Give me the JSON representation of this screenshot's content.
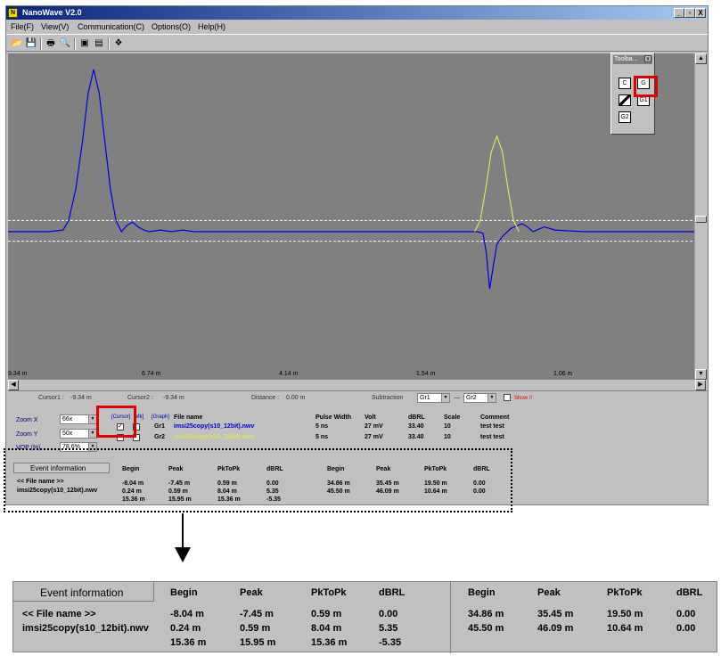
{
  "window": {
    "title": "NanoWave V2.0",
    "menus": [
      "File(F)",
      "View(V)",
      "Communication(C)",
      "Options(O)",
      "Help(H)"
    ],
    "caption_buttons": [
      "_",
      "▫",
      "X"
    ]
  },
  "palette": {
    "title": "Toolba...",
    "close": "x",
    "buttons": [
      "C",
      "G",
      "",
      "G1",
      "G2"
    ]
  },
  "plot": {
    "background": "#808080",
    "x_ticks": [
      "9.34 m",
      "6.74 m",
      "4.14 m",
      "1.54 m",
      "1.06 m"
    ],
    "x_range": [
      -9.34,
      3.0
    ],
    "y_range": [
      -1.0,
      1.0
    ],
    "reference_lines": [
      -0.05,
      -0.18
    ],
    "series": [
      {
        "name": "Gr1",
        "color": "#0000e0",
        "points": [
          [
            -9.34,
            -0.12
          ],
          [
            -9.0,
            -0.12
          ],
          [
            -8.6,
            -0.12
          ],
          [
            -8.35,
            -0.11
          ],
          [
            -8.25,
            -0.05
          ],
          [
            -8.12,
            0.15
          ],
          [
            -8.0,
            0.45
          ],
          [
            -7.9,
            0.75
          ],
          [
            -7.8,
            0.9
          ],
          [
            -7.7,
            0.75
          ],
          [
            -7.6,
            0.45
          ],
          [
            -7.5,
            0.15
          ],
          [
            -7.4,
            -0.05
          ],
          [
            -7.3,
            -0.12
          ],
          [
            -7.2,
            -0.08
          ],
          [
            -7.1,
            -0.06
          ],
          [
            -7.0,
            -0.09
          ],
          [
            -6.9,
            -0.11
          ],
          [
            -6.8,
            -0.12
          ],
          [
            -6.6,
            -0.11
          ],
          [
            -6.4,
            -0.12
          ],
          [
            -6.2,
            -0.11
          ],
          [
            -6.0,
            -0.12
          ],
          [
            -5.0,
            -0.12
          ],
          [
            -2.2,
            -0.12
          ],
          [
            -0.9,
            -0.12
          ],
          [
            -0.8,
            -0.13
          ],
          [
            -0.74,
            -0.25
          ],
          [
            -0.68,
            -0.48
          ],
          [
            -0.62,
            -0.35
          ],
          [
            -0.55,
            -0.2
          ],
          [
            -0.45,
            -0.15
          ],
          [
            -0.3,
            -0.1
          ],
          [
            -0.1,
            -0.07
          ],
          [
            0.0,
            -0.09
          ],
          [
            0.1,
            -0.12
          ],
          [
            0.3,
            -0.09
          ],
          [
            0.5,
            -0.11
          ],
          [
            1.0,
            -0.12
          ],
          [
            2.0,
            -0.12
          ],
          [
            3.0,
            -0.12
          ]
        ]
      },
      {
        "name": "Gr2",
        "color": "#e0e060",
        "points": [
          [
            -0.95,
            -0.12
          ],
          [
            -0.85,
            -0.05
          ],
          [
            -0.75,
            0.15
          ],
          [
            -0.65,
            0.38
          ],
          [
            -0.55,
            0.48
          ],
          [
            -0.45,
            0.38
          ],
          [
            -0.35,
            0.15
          ],
          [
            -0.25,
            -0.05
          ],
          [
            -0.15,
            -0.12
          ]
        ]
      }
    ]
  },
  "info": {
    "cursor1_label": "Cursor1 :",
    "cursor1_value": "-9.34 m",
    "cursor2_label": "Cursor2 :",
    "cursor2_value": "-9.34 m",
    "distance_label": "Distance :",
    "distance_value": "0.00 m",
    "subtraction_label": "Subtraction",
    "sub_a": "Gr1",
    "sub_dash": "—",
    "sub_b": "Gr2",
    "show_label": "Show !!",
    "zoom_x_label": "Zoom X",
    "zoom_x_value": "66x",
    "zoom_y_label": "Zoom Y",
    "zoom_y_value": "50x",
    "vop_label": "VOP (%)",
    "vop_value": "78.6%",
    "hdr_cursor": "[Cursor]",
    "hdr_mark": "[Mk]",
    "hdr_graph": "[Graph]",
    "hdr_file": "File name",
    "hdr_pw": "Pulse Width",
    "hdr_volt": "Volt",
    "hdr_dbrl": "dBRL",
    "hdr_scale": "Scale",
    "hdr_comment": "Comment",
    "rows": [
      {
        "graph": "Gr1",
        "file": "imsi25copy(s10_12bit).nwv",
        "pw": "5 ns",
        "volt": "27 mV",
        "dbrl": "33.40",
        "scale": "10",
        "comment": "test test",
        "color": "#0000d0",
        "checked": true
      },
      {
        "graph": "Gr2",
        "file": "imsi25copy(s10_12bit).nwv",
        "pw": "5 ns",
        "volt": "27 mV",
        "dbrl": "33.40",
        "scale": "10",
        "comment": "test test",
        "color": "#e0e060",
        "checked": false
      }
    ]
  },
  "events": {
    "title": "Event information",
    "file_header": "<< File name >>",
    "file_name": "imsi25copy(s10_12bit).nwv",
    "headers": [
      "Begin",
      "Peak",
      "PkToPk",
      "dBRL"
    ],
    "left": [
      [
        "-8.04 m",
        "-7.45 m",
        "0.59 m",
        "0.00"
      ],
      [
        "0.24 m",
        "0.59 m",
        "8.04 m",
        "5.35"
      ],
      [
        "15.36 m",
        "15.95 m",
        "15.36 m",
        "-5.35"
      ]
    ],
    "right": [
      [
        "34.86 m",
        "35.45 m",
        "19.50 m",
        "0.00"
      ],
      [
        "45.50 m",
        "46.09 m",
        "10.64 m",
        "0.00"
      ]
    ]
  }
}
